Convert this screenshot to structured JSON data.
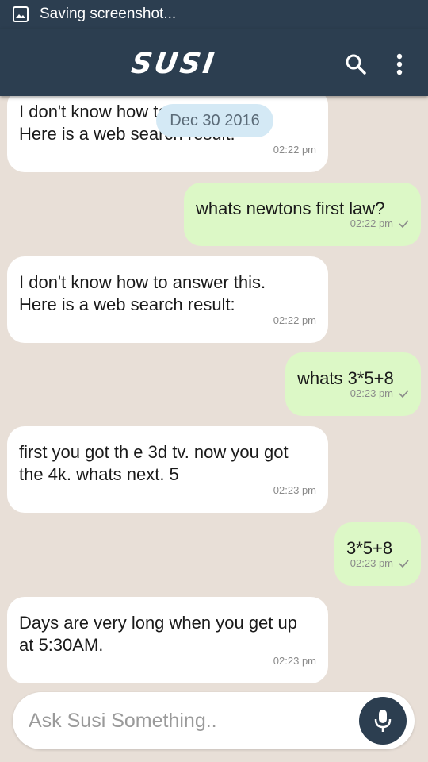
{
  "status_bar": {
    "icon": "image-icon",
    "text": "Saving screenshot..."
  },
  "app_bar": {
    "logo_text": "SUSI",
    "search_icon": "search-icon",
    "menu_icon": "more-vert-icon"
  },
  "date_chip": "Dec 30 2016",
  "messages": [
    {
      "side": "in",
      "lines": [
        "I don't know how to answer this.",
        "Here is a web search result:"
      ],
      "time": "02:22 pm"
    },
    {
      "side": "out",
      "lines": [
        "whats newtons first law?"
      ],
      "time": "02:22 pm"
    },
    {
      "side": "in",
      "lines": [
        "I don't know how to answer this.",
        "Here is a web search result:"
      ],
      "time": "02:22 pm"
    },
    {
      "side": "out",
      "lines": [
        "whats 3*5+8"
      ],
      "time": "02:23 pm"
    },
    {
      "side": "in",
      "lines": [
        "first you got th e 3d tv. now you got",
        "the 4k. whats next. 5"
      ],
      "time": "02:23 pm"
    },
    {
      "side": "out",
      "lines": [
        "3*5+8"
      ],
      "time": "02:23 pm"
    },
    {
      "side": "in",
      "lines": [
        "Days are very long when you get up",
        "at 5:30AM."
      ],
      "time": "02:23 pm"
    }
  ],
  "input": {
    "placeholder": "Ask Susi Something..",
    "value": ""
  },
  "mic_icon": "microphone-icon",
  "colors": {
    "primary": "#2c3e50",
    "chat_background": "#e8dfd7",
    "incoming_bubble": "#ffffff",
    "outgoing_bubble": "#dcf8c6",
    "date_chip": "#d4e9f5"
  }
}
